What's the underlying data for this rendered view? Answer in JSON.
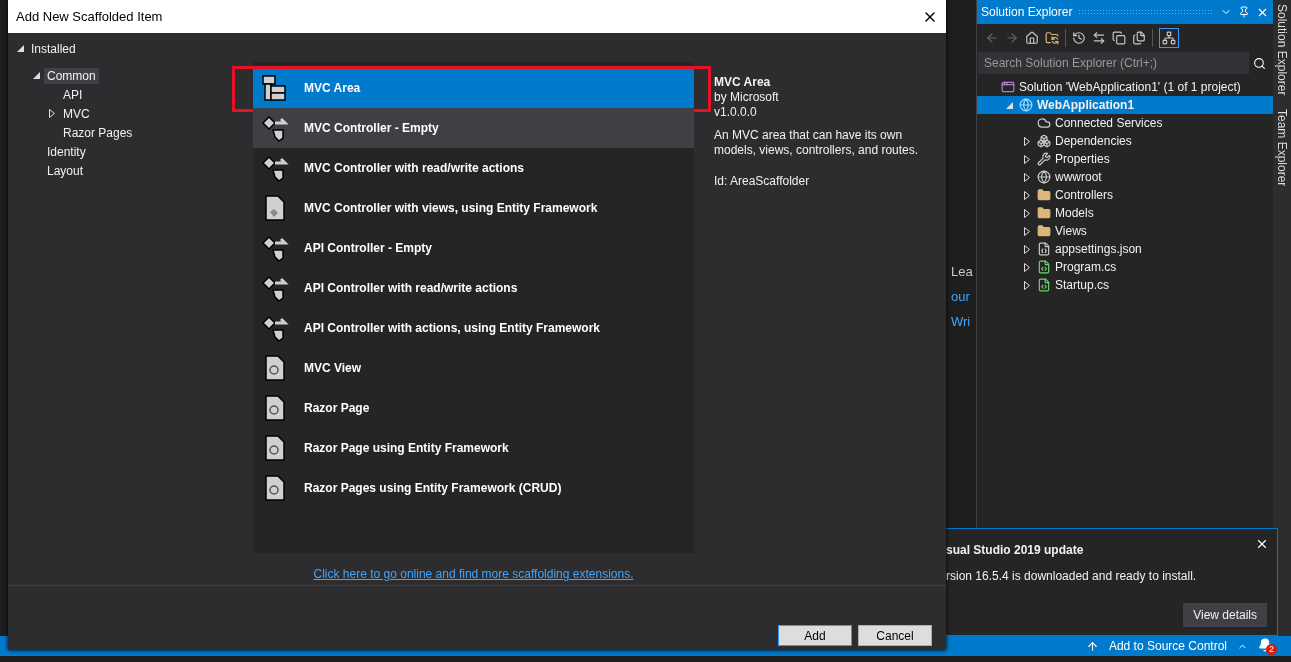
{
  "dialog": {
    "title": "Add New Scaffolded Item",
    "tree": [
      {
        "label": "Installed",
        "expanded": true,
        "selected": false,
        "children": [
          {
            "label": "Common",
            "expanded": true,
            "selected": true,
            "children": [
              {
                "label": "API",
                "selected": false
              },
              {
                "label": "MVC",
                "expanded": false,
                "selected": false
              },
              {
                "label": "Razor Pages",
                "selected": false
              }
            ]
          },
          {
            "label": "Identity",
            "selected": false
          },
          {
            "label": "Layout",
            "selected": false
          }
        ]
      }
    ],
    "templates": [
      {
        "label": "MVC Area",
        "kind": "area",
        "selected": true,
        "hovered": false,
        "highlighted": true
      },
      {
        "label": "MVC Controller - Empty",
        "kind": "controller",
        "selected": false,
        "hovered": true,
        "highlighted": false
      },
      {
        "label": "MVC Controller with read/write actions",
        "kind": "controller",
        "selected": false,
        "hovered": false,
        "highlighted": false
      },
      {
        "label": "MVC Controller with views, using Entity Framework",
        "kind": "views",
        "selected": false,
        "hovered": false,
        "highlighted": false
      },
      {
        "label": "API Controller - Empty",
        "kind": "controller",
        "selected": false,
        "hovered": false,
        "highlighted": false
      },
      {
        "label": "API Controller with read/write actions",
        "kind": "controller",
        "selected": false,
        "hovered": false,
        "highlighted": false
      },
      {
        "label": "API Controller with actions, using Entity Framework",
        "kind": "controller",
        "selected": false,
        "hovered": false,
        "highlighted": false
      },
      {
        "label": "MVC View",
        "kind": "view",
        "selected": false,
        "hovered": false,
        "highlighted": false
      },
      {
        "label": "Razor Page",
        "kind": "view",
        "selected": false,
        "hovered": false,
        "highlighted": false
      },
      {
        "label": "Razor Page using Entity Framework",
        "kind": "view",
        "selected": false,
        "hovered": false,
        "highlighted": false
      },
      {
        "label": "Razor Pages using Entity Framework (CRUD)",
        "kind": "view",
        "selected": false,
        "hovered": false,
        "highlighted": false
      }
    ],
    "details": {
      "title": "MVC Area",
      "publisher": "by Microsoft",
      "version": "v1.0.0.0",
      "description": "An MVC area that can have its own models, views, controllers, and routes.",
      "id": "Id: AreaScaffolder"
    },
    "link": "Click here to go online and find more scaffolding extensions.",
    "buttons": [
      {
        "label": "Add",
        "default": true
      },
      {
        "label": "Cancel",
        "default": false
      }
    ]
  },
  "editor_fragments": [
    {
      "text": "Lea",
      "kind": "text"
    },
    {
      "text": "our",
      "kind": "link"
    },
    {
      "text": "Wri",
      "kind": "link"
    }
  ],
  "solution_explorer": {
    "title": "Solution Explorer",
    "search": {
      "placeholder": "Search Solution Explorer (Ctrl+;)"
    },
    "tree": [
      {
        "label": "Solution 'WebApplication1' (1 of 1 project)",
        "kind": "solution",
        "selected": false,
        "children": [
          {
            "label": "WebApplication1",
            "kind": "project",
            "expanded": true,
            "selected": true,
            "children": [
              {
                "label": "Connected Services",
                "kind": "cloud",
                "selected": false
              },
              {
                "label": "Dependencies",
                "kind": "dependencies",
                "expanded": false,
                "selected": false
              },
              {
                "label": "Properties",
                "kind": "wrench",
                "expanded": false,
                "selected": false
              },
              {
                "label": "wwwroot",
                "kind": "globe",
                "expanded": false,
                "selected": false
              },
              {
                "label": "Controllers",
                "kind": "folder",
                "expanded": false,
                "selected": false
              },
              {
                "label": "Models",
                "kind": "folder",
                "expanded": false,
                "selected": false
              },
              {
                "label": "Views",
                "kind": "folder",
                "expanded": false,
                "selected": false
              },
              {
                "label": "appsettings.json",
                "kind": "json",
                "expanded": false,
                "selected": false
              },
              {
                "label": "Program.cs",
                "kind": "csharp",
                "expanded": false,
                "selected": false
              },
              {
                "label": "Startup.cs",
                "kind": "csharp",
                "expanded": false,
                "selected": false
              }
            ]
          }
        ]
      }
    ]
  },
  "side_tabs": [
    "Solution Explorer",
    "Team Explorer"
  ],
  "notification": {
    "title": "sual Studio 2019 update",
    "message": "rsion 16.5.4 is downloaded and ready to install.",
    "button": "View details"
  },
  "status_bar": {
    "source_control": "Add to Source Control",
    "notification_count": "2"
  }
}
